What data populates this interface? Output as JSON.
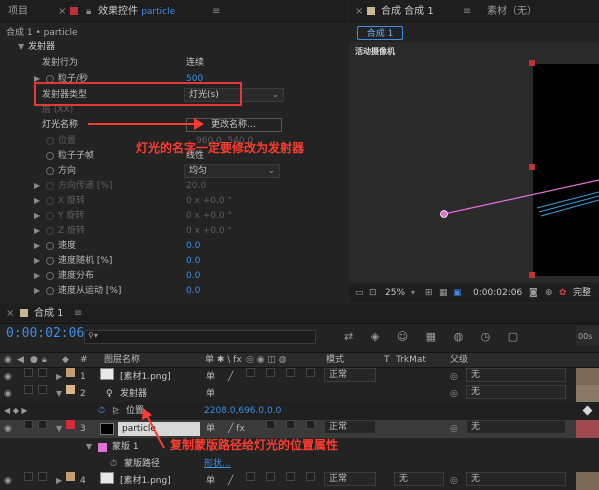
{
  "effect_panel": {
    "tab_project": "项目",
    "tab_effects_prefix": "效果控件",
    "tab_effects_layer": "particle",
    "breadcrumb": "合成 1 • particle",
    "rows": [
      {
        "label": "发射器",
        "value": ""
      },
      {
        "label": "发射行为",
        "value": "连续"
      },
      {
        "label": "粒子/秒",
        "value": "500"
      },
      {
        "label": "发射器类型",
        "value": "灯光(s)"
      },
      {
        "label": "层 (XX)",
        "value": ""
      },
      {
        "label": "灯光名称",
        "value": "更改名称..."
      },
      {
        "label": "位置",
        "value": "960.0, 540.0"
      },
      {
        "label": "粒子子帧",
        "value": "线性"
      },
      {
        "label": "方向",
        "value": "均匀"
      },
      {
        "label": "方向传递 [%]",
        "value": "20.0"
      },
      {
        "label": "X 旋转",
        "value": "0 x +0.0 °"
      },
      {
        "label": "Y 旋转",
        "value": "0 x +0.0 °"
      },
      {
        "label": "Z 旋转",
        "value": "0 x +0.0 °"
      },
      {
        "label": "速度",
        "value": "0.0"
      },
      {
        "label": "速度随机 [%]",
        "value": "0.0"
      },
      {
        "label": "速度分布",
        "value": "0.0"
      },
      {
        "label": "速度从运动 [%]",
        "value": "0.0"
      }
    ],
    "annotation": "灯光的名字一定要修改为发射器"
  },
  "comp_panel": {
    "tab_comp": "合成 合成 1",
    "tab_footage": "素材（无）",
    "subtab": "合成 1",
    "camera_label": "活动摄像机",
    "zoom": "25%",
    "timecode": "0:00:02:06",
    "quality": "完整"
  },
  "timeline": {
    "tab": "合成 1",
    "timecode": "0:00:02:06",
    "search_placeholder": "",
    "headers": {
      "number": "#",
      "layer_name": "图层名称",
      "switches": "单 ✱ \\ fx",
      "mode": "模式",
      "t": "T",
      "trkmat": "TrkMat",
      "parent": "父级",
      "ruler": "00s"
    },
    "layers": [
      {
        "num": "1",
        "name": "[素材1.png]",
        "mode": "正常",
        "parent": "无",
        "color": "#c49f74"
      },
      {
        "num": "2",
        "name": "发射器",
        "mode": "",
        "parent": "无",
        "color": "#d8b68a"
      },
      {
        "num": "",
        "name": "位置",
        "value": "2208.0,696.0,0.0"
      },
      {
        "num": "3",
        "name": "particle",
        "mode": "正常",
        "parent": "无",
        "color": "#d02c3a"
      },
      {
        "num": "",
        "name": "蒙版 1",
        "value": ""
      },
      {
        "num": "",
        "name": "蒙版路径",
        "value": "形状..."
      },
      {
        "num": "4",
        "name": "[素材1.png]",
        "mode": "正常",
        "trkmat": "无",
        "parent": "无",
        "color": "#c49f74"
      }
    ],
    "annotation": "复制蒙版路径给灯光的位置属性"
  },
  "colors": {
    "accent_blue": "#3d8ee8",
    "annotation_red": "#ff3b30",
    "pink_path": "#e070d8"
  }
}
